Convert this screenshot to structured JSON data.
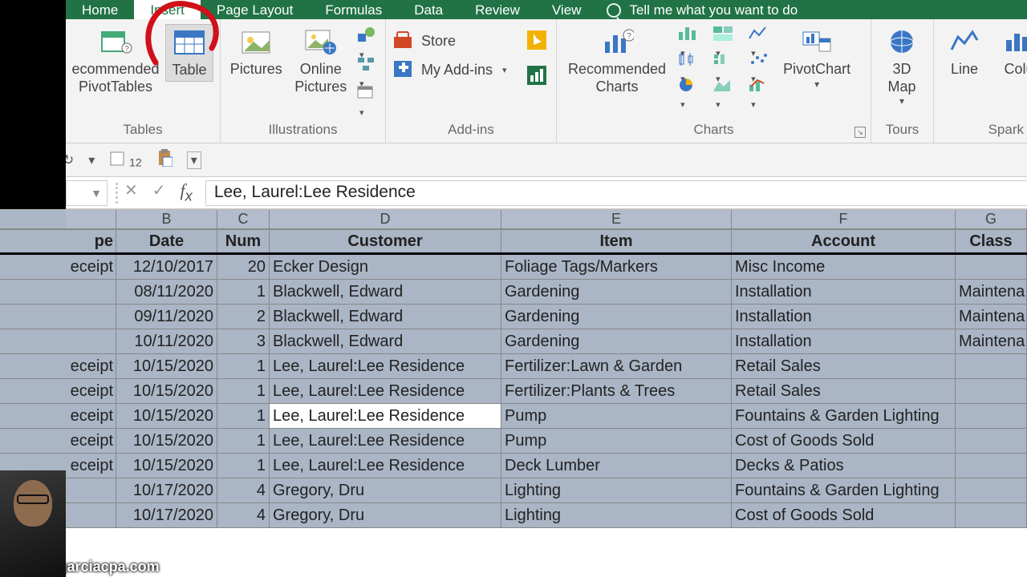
{
  "tabs": {
    "home": "Home",
    "insert": "Insert",
    "page_layout": "Page Layout",
    "formulas": "Formulas",
    "data": "Data",
    "review": "Review",
    "view": "View",
    "tell_me": "Tell me what you want to do"
  },
  "ribbon": {
    "tables": {
      "label": "Tables",
      "recommended_pt": "ecommended\nPivotTables",
      "table": "Table"
    },
    "illustrations": {
      "label": "Illustrations",
      "pictures": "Pictures",
      "online_pictures": "Online\nPictures"
    },
    "addins": {
      "label": "Add-ins",
      "store": "Store",
      "my_addins": "My Add-ins"
    },
    "charts": {
      "label": "Charts",
      "recommended": "Recommended\nCharts",
      "pivotchart": "PivotChart"
    },
    "tours": {
      "label": "Tours",
      "map3d": "3D\nMap"
    },
    "spark": {
      "label": "Spark",
      "line": "Line",
      "column": "Colu"
    }
  },
  "quick": {
    "font_size": "12"
  },
  "formula_bar": {
    "value": "Lee, Laurel:Lee Residence"
  },
  "columns": {
    "A": "",
    "B": "B",
    "C": "C",
    "D": "D",
    "E": "E",
    "F": "F",
    "G": "G"
  },
  "headers": {
    "A": "pe",
    "B": "Date",
    "C": "Num",
    "D": "Customer",
    "E": "Item",
    "F": "Account",
    "G": "Class"
  },
  "rows": [
    {
      "A": "eceipt",
      "B": "12/10/2017",
      "C": "20",
      "D": "Ecker Design",
      "E": "Foliage Tags/Markers",
      "F": "Misc Income",
      "G": ""
    },
    {
      "A": "",
      "B": "08/11/2020",
      "C": "1",
      "D": "Blackwell, Edward",
      "E": "Gardening",
      "F": "Installation",
      "G": "Maintena"
    },
    {
      "A": "",
      "B": "09/11/2020",
      "C": "2",
      "D": "Blackwell, Edward",
      "E": "Gardening",
      "F": "Installation",
      "G": "Maintena"
    },
    {
      "A": "",
      "B": "10/11/2020",
      "C": "3",
      "D": "Blackwell, Edward",
      "E": "Gardening",
      "F": "Installation",
      "G": "Maintena"
    },
    {
      "A": "eceipt",
      "B": "10/15/2020",
      "C": "1",
      "D": "Lee, Laurel:Lee Residence",
      "E": "Fertilizer:Lawn & Garden",
      "F": "Retail Sales",
      "G": ""
    },
    {
      "A": "eceipt",
      "B": "10/15/2020",
      "C": "1",
      "D": "Lee, Laurel:Lee Residence",
      "E": "Fertilizer:Plants & Trees",
      "F": "Retail Sales",
      "G": ""
    },
    {
      "A": "eceipt",
      "B": "10/15/2020",
      "C": "1",
      "D": "Lee, Laurel:Lee Residence",
      "E": "Pump",
      "F": "Fountains & Garden Lighting",
      "G": ""
    },
    {
      "A": "eceipt",
      "B": "10/15/2020",
      "C": "1",
      "D": "Lee, Laurel:Lee Residence",
      "E": "Pump",
      "F": "Cost of Goods Sold",
      "G": ""
    },
    {
      "A": "eceipt",
      "B": "10/15/2020",
      "C": "1",
      "D": "Lee, Laurel:Lee Residence",
      "E": "Deck Lumber",
      "F": "Decks & Patios",
      "G": ""
    },
    {
      "A": "",
      "B": "10/17/2020",
      "C": "4",
      "D": "Gregory, Dru",
      "E": "Lighting",
      "F": "Fountains & Garden Lighting",
      "G": ""
    },
    {
      "A": "",
      "B": "10/17/2020",
      "C": "4",
      "D": "Gregory, Dru",
      "E": "Lighting",
      "F": "Cost of Goods Sold",
      "G": ""
    }
  ],
  "active_cell": {
    "row_index": 6,
    "col": "D"
  },
  "overlay": {
    "email": "hector@garciacpa.com"
  }
}
